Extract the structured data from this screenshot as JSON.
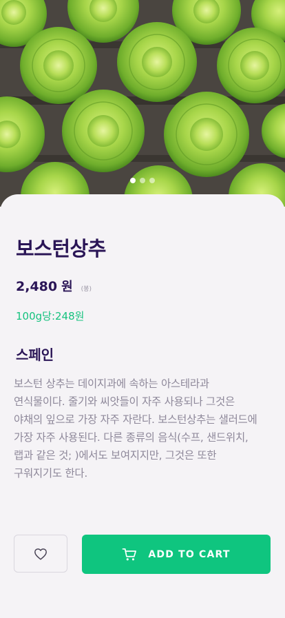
{
  "hero": {
    "image_icon": "lettuce-photo",
    "slides": [
      {
        "active": true
      },
      {
        "active": false
      },
      {
        "active": false
      }
    ]
  },
  "product": {
    "name": "보스턴상추",
    "price": "2,480",
    "currency": "원",
    "unit": "(봉)",
    "unit_price": "100g당:248원",
    "origin": "스페인",
    "description": "보스턴 상추는 데이지과에 속하는 아스테라과 연식물이다. 줄기와 씨앗들이 자주 사용되나 그것은 야채의 잎으로 가장 자주 자란다. 보스턴상추는 샐러드에 가장 자주 사용된다. 다른 종류의 음식(수프, 샌드위치, 랩과 같은 것; )에서도 보여지지만, 그것은 또한 구워지기도 한다."
  },
  "actions": {
    "favorite_icon": "heart-icon",
    "cart_icon": "cart-icon",
    "add_to_cart_label": "ADD TO CART"
  },
  "colors": {
    "title": "#2a1556",
    "accent_green": "#0fc57f",
    "unit_price_green": "#15c27e",
    "body_text": "#8e889a",
    "background": "#f5f3f6"
  }
}
